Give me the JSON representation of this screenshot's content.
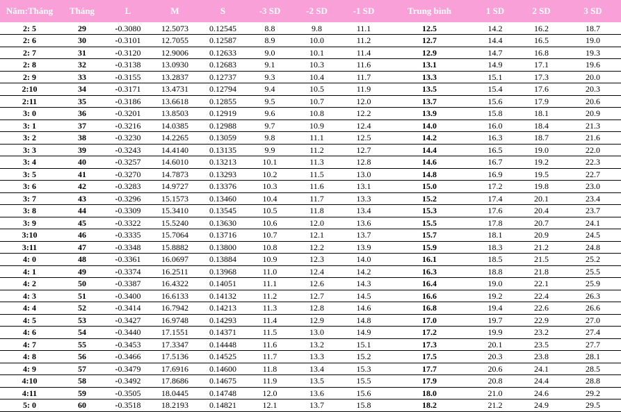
{
  "table": {
    "headers": [
      "Năm:Tháng",
      "Tháng",
      "L",
      "M",
      "S",
      "-3 SD",
      "-2 SD",
      "-1 SD",
      "Trung bình",
      "1 SD",
      "2 SD",
      "3 SD"
    ],
    "rows": [
      [
        "2: 5",
        "29",
        "0.3080",
        "12.5073",
        "0.12545",
        "8.8",
        "9.8",
        "11.1",
        "12.5",
        "14.2",
        "16.2",
        "18.7"
      ],
      [
        "2: 6",
        "30",
        "0.3101",
        "12.7055",
        "0.12587",
        "8.9",
        "10.0",
        "11.2",
        "12.7",
        "14.4",
        "16.5",
        "19.0"
      ],
      [
        "2: 7",
        "31",
        "0.3120",
        "12.9006",
        "0.12633",
        "9.0",
        "10.1",
        "11.4",
        "12.9",
        "14.7",
        "16.8",
        "19.3"
      ],
      [
        "2: 8",
        "32",
        "0.3138",
        "13.0930",
        "0.12683",
        "9.1",
        "10.3",
        "11.6",
        "13.1",
        "14.9",
        "17.1",
        "19.6"
      ],
      [
        "2: 9",
        "33",
        "0.3155",
        "13.2837",
        "0.12737",
        "9.3",
        "10.4",
        "11.7",
        "13.3",
        "15.1",
        "17.3",
        "20.0"
      ],
      [
        "2:10",
        "34",
        "0.3171",
        "13.4731",
        "0.12794",
        "9.4",
        "10.5",
        "11.9",
        "13.5",
        "15.4",
        "17.6",
        "20.3"
      ],
      [
        "2:11",
        "35",
        "0.3186",
        "13.6618",
        "0.12855",
        "9.5",
        "10.7",
        "12.0",
        "13.7",
        "15.6",
        "17.9",
        "20.6"
      ],
      [
        "3: 0",
        "36",
        "0.3201",
        "13.8503",
        "0.12919",
        "9.6",
        "10.8",
        "12.2",
        "13.9",
        "15.8",
        "18.1",
        "20.9"
      ],
      [
        "3: 1",
        "37",
        "0.3216",
        "14.0385",
        "0.12988",
        "9.7",
        "10.9",
        "12.4",
        "14.0",
        "16.0",
        "18.4",
        "21.3"
      ],
      [
        "3: 2",
        "38",
        "0.3230",
        "14.2265",
        "0.13059",
        "9.8",
        "11.1",
        "12.5",
        "14.2",
        "16.3",
        "18.7",
        "21.6"
      ],
      [
        "3: 3",
        "39",
        "0.3243",
        "14.4140",
        "0.13135",
        "9.9",
        "11.2",
        "12.7",
        "14.4",
        "16.5",
        "19.0",
        "22.0"
      ],
      [
        "3: 4",
        "40",
        "0.3257",
        "14.6010",
        "0.13213",
        "10.1",
        "11.3",
        "12.8",
        "14.6",
        "16.7",
        "19.2",
        "22.3"
      ],
      [
        "3: 5",
        "41",
        "0.3270",
        "14.7873",
        "0.13293",
        "10.2",
        "11.5",
        "13.0",
        "14.8",
        "16.9",
        "19.5",
        "22.7"
      ],
      [
        "3: 6",
        "42",
        "0.3283",
        "14.9727",
        "0.13376",
        "10.3",
        "11.6",
        "13.1",
        "15.0",
        "17.2",
        "19.8",
        "23.0"
      ],
      [
        "3: 7",
        "43",
        "0.3296",
        "15.1573",
        "0.13460",
        "10.4",
        "11.7",
        "13.3",
        "15.2",
        "17.4",
        "20.1",
        "23.4"
      ],
      [
        "3: 8",
        "44",
        "0.3309",
        "15.3410",
        "0.13545",
        "10.5",
        "11.8",
        "13.4",
        "15.3",
        "17.6",
        "20.4",
        "23.7"
      ],
      [
        "3: 9",
        "45",
        "0.3322",
        "15.5240",
        "0.13630",
        "10.6",
        "12.0",
        "13.6",
        "15.5",
        "17.8",
        "20.7",
        "24.1"
      ],
      [
        "3:10",
        "46",
        "0.3335",
        "15.7064",
        "0.13716",
        "10.7",
        "12.1",
        "13.7",
        "15.7",
        "18.1",
        "20.9",
        "24.5"
      ],
      [
        "3:11",
        "47",
        "0.3348",
        "15.8882",
        "0.13800",
        "10.8",
        "12.2",
        "13.9",
        "15.9",
        "18.3",
        "21.2",
        "24.8"
      ],
      [
        "4: 0",
        "48",
        "0.3361",
        "16.0697",
        "0.13884",
        "10.9",
        "12.3",
        "14.0",
        "16.1",
        "18.5",
        "21.5",
        "25.2"
      ],
      [
        "4: 1",
        "49",
        "0.3374",
        "16.2511",
        "0.13968",
        "11.0",
        "12.4",
        "14.2",
        "16.3",
        "18.8",
        "21.8",
        "25.5"
      ],
      [
        "4: 2",
        "50",
        "0.3387",
        "16.4322",
        "0.14051",
        "11.1",
        "12.6",
        "14.3",
        "16.4",
        "19.0",
        "22.1",
        "25.9"
      ],
      [
        "4: 3",
        "51",
        "0.3400",
        "16.6133",
        "0.14132",
        "11.2",
        "12.7",
        "14.5",
        "16.6",
        "19.2",
        "22.4",
        "26.3"
      ],
      [
        "4: 4",
        "52",
        "0.3414",
        "16.7942",
        "0.14213",
        "11.3",
        "12.8",
        "14.6",
        "16.8",
        "19.4",
        "22.6",
        "26.6"
      ],
      [
        "4: 5",
        "53",
        "0.3427",
        "16.9748",
        "0.14293",
        "11.4",
        "12.9",
        "14.8",
        "17.0",
        "19.7",
        "22.9",
        "27.0"
      ],
      [
        "4: 6",
        "54",
        "0.3440",
        "17.1551",
        "0.14371",
        "11.5",
        "13.0",
        "14.9",
        "17.2",
        "19.9",
        "23.2",
        "27.4"
      ],
      [
        "4: 7",
        "55",
        "0.3453",
        "17.3347",
        "0.14448",
        "11.6",
        "13.2",
        "15.1",
        "17.3",
        "20.1",
        "23.5",
        "27.7"
      ],
      [
        "4: 8",
        "56",
        "0.3466",
        "17.5136",
        "0.14525",
        "11.7",
        "13.3",
        "15.2",
        "17.5",
        "20.3",
        "23.8",
        "28.1"
      ],
      [
        "4: 9",
        "57",
        "0.3479",
        "17.6916",
        "0.14600",
        "11.8",
        "13.4",
        "15.3",
        "17.7",
        "20.6",
        "24.1",
        "28.5"
      ],
      [
        "4:10",
        "58",
        "0.3492",
        "17.8686",
        "0.14675",
        "11.9",
        "13.5",
        "15.5",
        "17.9",
        "20.8",
        "24.4",
        "28.8"
      ],
      [
        "4:11",
        "59",
        "0.3505",
        "18.0445",
        "0.14748",
        "12.0",
        "13.6",
        "15.6",
        "18.0",
        "21.0",
        "24.6",
        "29.2"
      ],
      [
        "5: 0",
        "60",
        "0.3518",
        "18.2193",
        "0.14821",
        "12.1",
        "13.7",
        "15.8",
        "18.2",
        "21.2",
        "24.9",
        "29.5"
      ]
    ],
    "l_sign": "-"
  }
}
